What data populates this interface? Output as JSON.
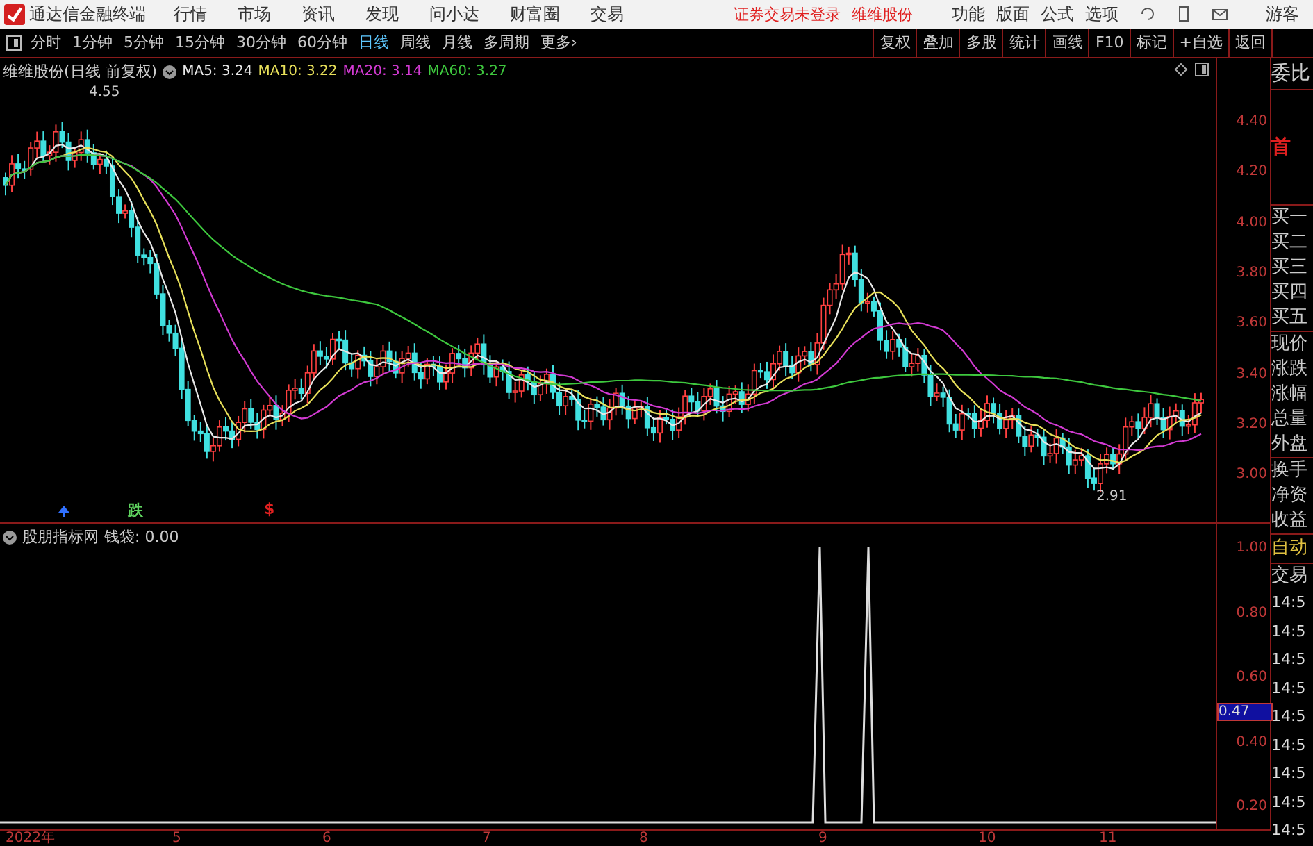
{
  "app": {
    "title": "通达信金融终端",
    "menu": [
      "行情",
      "市场",
      "资讯",
      "发现",
      "问小达",
      "财富圈",
      "交易"
    ],
    "notices": [
      "证券交易未登录",
      "维维股份"
    ],
    "right_menu": [
      "功能",
      "版面",
      "公式",
      "选项"
    ],
    "user": "游客"
  },
  "periods": [
    {
      "label": "分时",
      "selected": false
    },
    {
      "label": "1分钟",
      "selected": false
    },
    {
      "label": "5分钟",
      "selected": false
    },
    {
      "label": "15分钟",
      "selected": false
    },
    {
      "label": "30分钟",
      "selected": false
    },
    {
      "label": "60分钟",
      "selected": false
    },
    {
      "label": "日线",
      "selected": true
    },
    {
      "label": "周线",
      "selected": false
    },
    {
      "label": "月线",
      "selected": false
    },
    {
      "label": "多周期",
      "selected": false
    },
    {
      "label": "更多›",
      "selected": false
    }
  ],
  "tools": [
    "复权",
    "叠加",
    "多股",
    "统计",
    "画线",
    "F10",
    "标记",
    "+自选",
    "返回"
  ],
  "main_chart": {
    "title": "维维股份(日线 前复权)",
    "ma": [
      {
        "label": "MA5: 3.24",
        "color": "#e8e8e8"
      },
      {
        "label": "MA10: 3.22",
        "color": "#e8e05a"
      },
      {
        "label": "MA20: 3.14",
        "color": "#d23ad2"
      },
      {
        "label": "MA60: 3.27",
        "color": "#3ec83e"
      }
    ],
    "high_label": "4.55",
    "low_label": "2.91",
    "signals": [
      {
        "text": "跌",
        "color": "#5fd35f"
      },
      {
        "text": "$",
        "color": "#e02020"
      }
    ],
    "price_ticks": [
      "4.40",
      "4.20",
      "4.00",
      "3.80",
      "3.60",
      "3.40",
      "3.20",
      "3.00"
    ]
  },
  "indicator": {
    "title": "股朋指标网",
    "value": "钱袋: 0.00",
    "ticks": [
      "1.00",
      "0.80",
      "0.60",
      "0.40",
      "0.20"
    ],
    "cursor_value": "0.47"
  },
  "dates": [
    "2022年",
    "5",
    "6",
    "7",
    "8",
    "9",
    "10",
    "11"
  ],
  "quote_panel": {
    "header": "委比",
    "badge": "首",
    "bids": [
      "买一",
      "买二",
      "买三",
      "买四",
      "买五"
    ],
    "stats": [
      "现价",
      "涨跌",
      "涨幅",
      "总量",
      "外盘"
    ],
    "more": [
      "换手",
      "净资",
      "收益"
    ],
    "auto": "自动",
    "trades_label": "交易",
    "trades": [
      "14:5",
      "14:5",
      "14:5",
      "14:5",
      "14:5",
      "14:5",
      "14:5",
      "14:5",
      "14:5"
    ]
  }
}
